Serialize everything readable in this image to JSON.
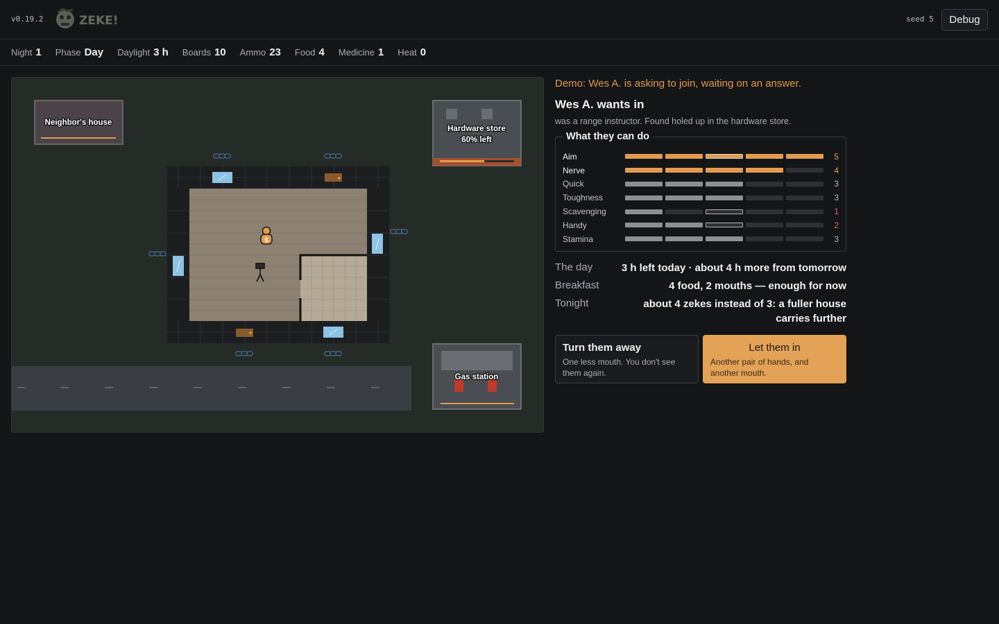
{
  "app": {
    "version": "v0.19.2",
    "logo_text": "ZEKE!",
    "seed_label": "seed 5",
    "debug_label": "Debug"
  },
  "stats": [
    {
      "label": "Night",
      "value": "1"
    },
    {
      "label": "Phase",
      "value": "Day"
    },
    {
      "label": "Daylight",
      "value": "3 h"
    },
    {
      "label": "Boards",
      "value": "10"
    },
    {
      "label": "Ammo",
      "value": "23"
    },
    {
      "label": "Food",
      "value": "4"
    },
    {
      "label": "Medicine",
      "value": "1"
    },
    {
      "label": "Heat",
      "value": "0"
    }
  ],
  "map": {
    "neighbor": {
      "label": "Neighbor's house"
    },
    "hardware": {
      "label": "Hardware store",
      "sub": "60% left",
      "remaining": 0.6
    },
    "gas": {
      "label": "Gas station"
    },
    "survivor_badge": "S",
    "colors": {
      "accent": "#e39c4f",
      "window": "#8cc3e6",
      "door": "#8b5a2b",
      "grass": "#252b26",
      "road": "#3a3d41"
    }
  },
  "panel": {
    "demo_line": "Demo: Wes A. is asking to join, waiting on an answer.",
    "title": "Wes A. wants in",
    "description": "was a range instructor. Found holed up in the hardware store.",
    "skills_title": "What they can do",
    "skills": [
      {
        "name": "Aim",
        "value": "5",
        "tone": "hi",
        "bars": [
          "hi",
          "hi",
          "hi pot",
          "hi",
          "hi"
        ]
      },
      {
        "name": "Nerve",
        "value": "4",
        "tone": "hi",
        "bars": [
          "hi",
          "hi",
          "hi",
          "hi",
          ""
        ]
      },
      {
        "name": "Quick",
        "value": "3",
        "tone": "",
        "bars": [
          "on",
          "on",
          "on",
          "",
          ""
        ]
      },
      {
        "name": "Toughness",
        "value": "3",
        "tone": "",
        "bars": [
          "on",
          "on",
          "on",
          "",
          ""
        ]
      },
      {
        "name": "Scavenging",
        "value": "1",
        "tone": "lo",
        "bars": [
          "on",
          "",
          "pot",
          "",
          ""
        ]
      },
      {
        "name": "Handy",
        "value": "2",
        "tone": "lo",
        "bars": [
          "on",
          "on",
          "pot",
          "",
          ""
        ]
      },
      {
        "name": "Stamina",
        "value": "3",
        "tone": "",
        "bars": [
          "on",
          "on",
          "on",
          "",
          ""
        ]
      }
    ],
    "info": [
      {
        "key": "The day",
        "value": "3 h left today · about 4 h more from tomorrow"
      },
      {
        "key": "Breakfast",
        "value": "4 food, 2 mouths — enough for now"
      },
      {
        "key": "Tonight",
        "value": "about 4 zekes instead of 3: a fuller house carries further"
      }
    ],
    "choices": {
      "away": {
        "title": "Turn them away",
        "desc": "One less mouth. You don't see them again."
      },
      "in": {
        "title": "Let them in",
        "desc": "Another pair of hands, and another mouth."
      }
    }
  }
}
